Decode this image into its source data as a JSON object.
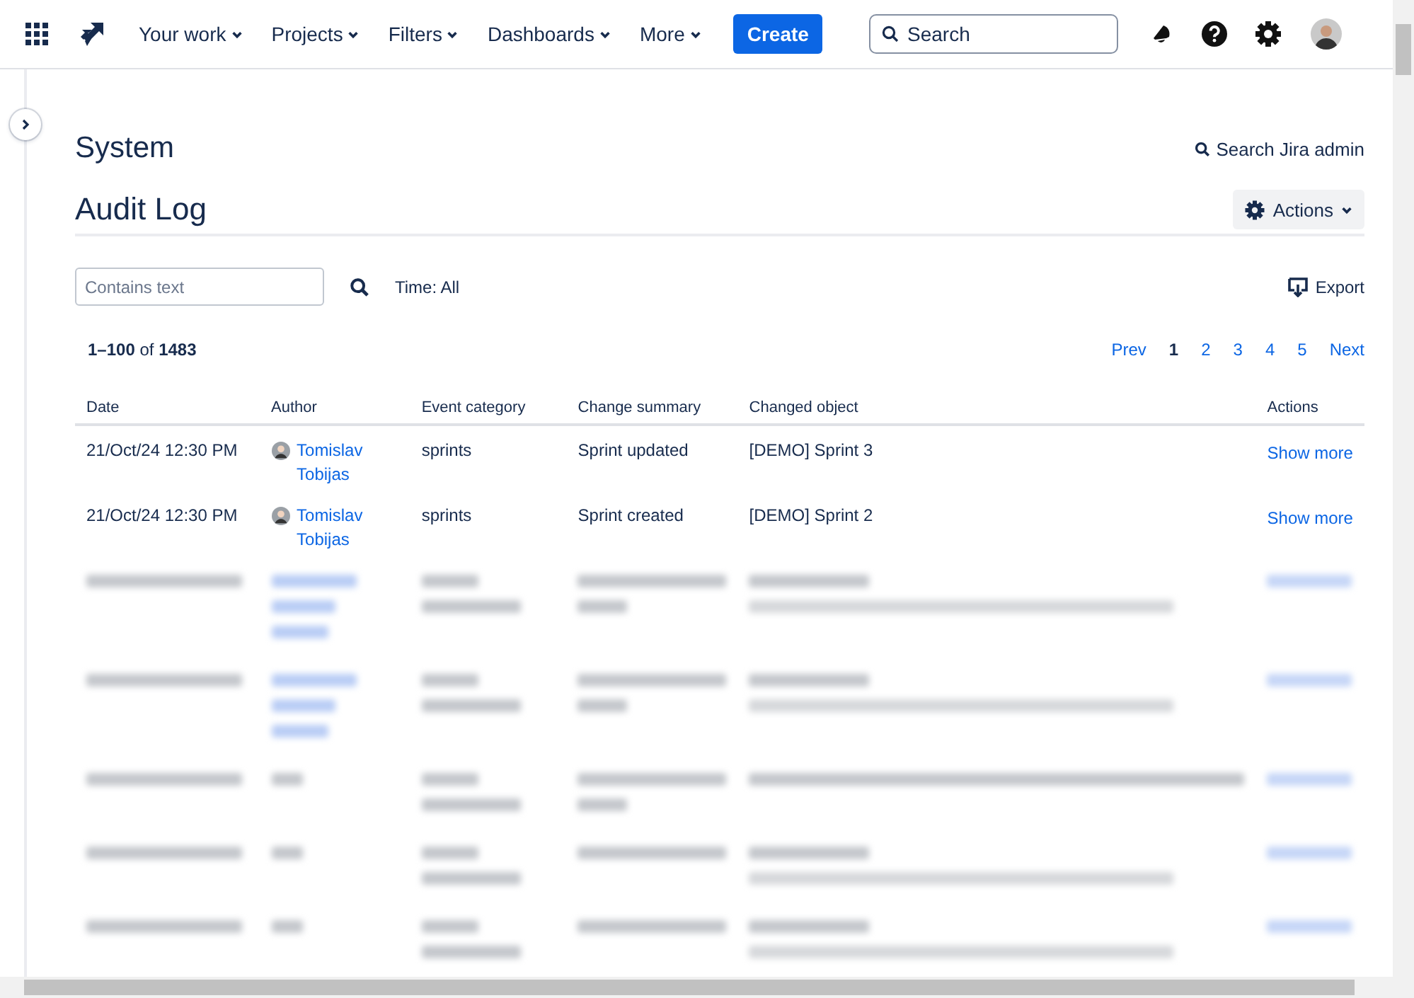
{
  "nav": {
    "items": [
      {
        "label": "Your work"
      },
      {
        "label": "Projects"
      },
      {
        "label": "Filters"
      },
      {
        "label": "Dashboards"
      },
      {
        "label": "More"
      }
    ],
    "create": "Create",
    "search": {
      "placeholder": "Search"
    }
  },
  "page": {
    "section": "System",
    "admin_search": "Search Jira admin",
    "title": "Audit Log",
    "actions": "Actions"
  },
  "filter": {
    "placeholder": "Contains text",
    "time": "Time: All",
    "export": "Export"
  },
  "range": "**1–100** of **1483**",
  "pagination": {
    "prev": "Prev",
    "next": "Next",
    "pages": [
      {
        "label": "1",
        "selected": true
      },
      {
        "label": "2",
        "selected": false
      },
      {
        "label": "3",
        "selected": false
      },
      {
        "label": "4",
        "selected": false
      },
      {
        "label": "5",
        "selected": false
      }
    ]
  },
  "table": {
    "columns": [
      "Date",
      "Author",
      "Event category",
      "Change summary",
      "Changed object",
      "Actions"
    ],
    "rows": [
      {
        "kind": "event",
        "date": "21/Oct/24 12:30 PM",
        "author": "Tomislav Tobijas",
        "category": "sprints",
        "summary": "Sprint updated",
        "object": "[DEMO] Sprint 3",
        "action": "Show more"
      },
      {
        "kind": "event",
        "date": "21/Oct/24 12:30 PM",
        "author": "Tomislav Tobijas",
        "category": "sprints",
        "summary": "Sprint created",
        "object": "[DEMO] Sprint 2",
        "action": "Show more"
      },
      {
        "kind": "blurred"
      },
      {
        "kind": "blurred"
      },
      {
        "kind": "blurred"
      },
      {
        "kind": "blurred"
      },
      {
        "kind": "blurred"
      }
    ]
  }
}
